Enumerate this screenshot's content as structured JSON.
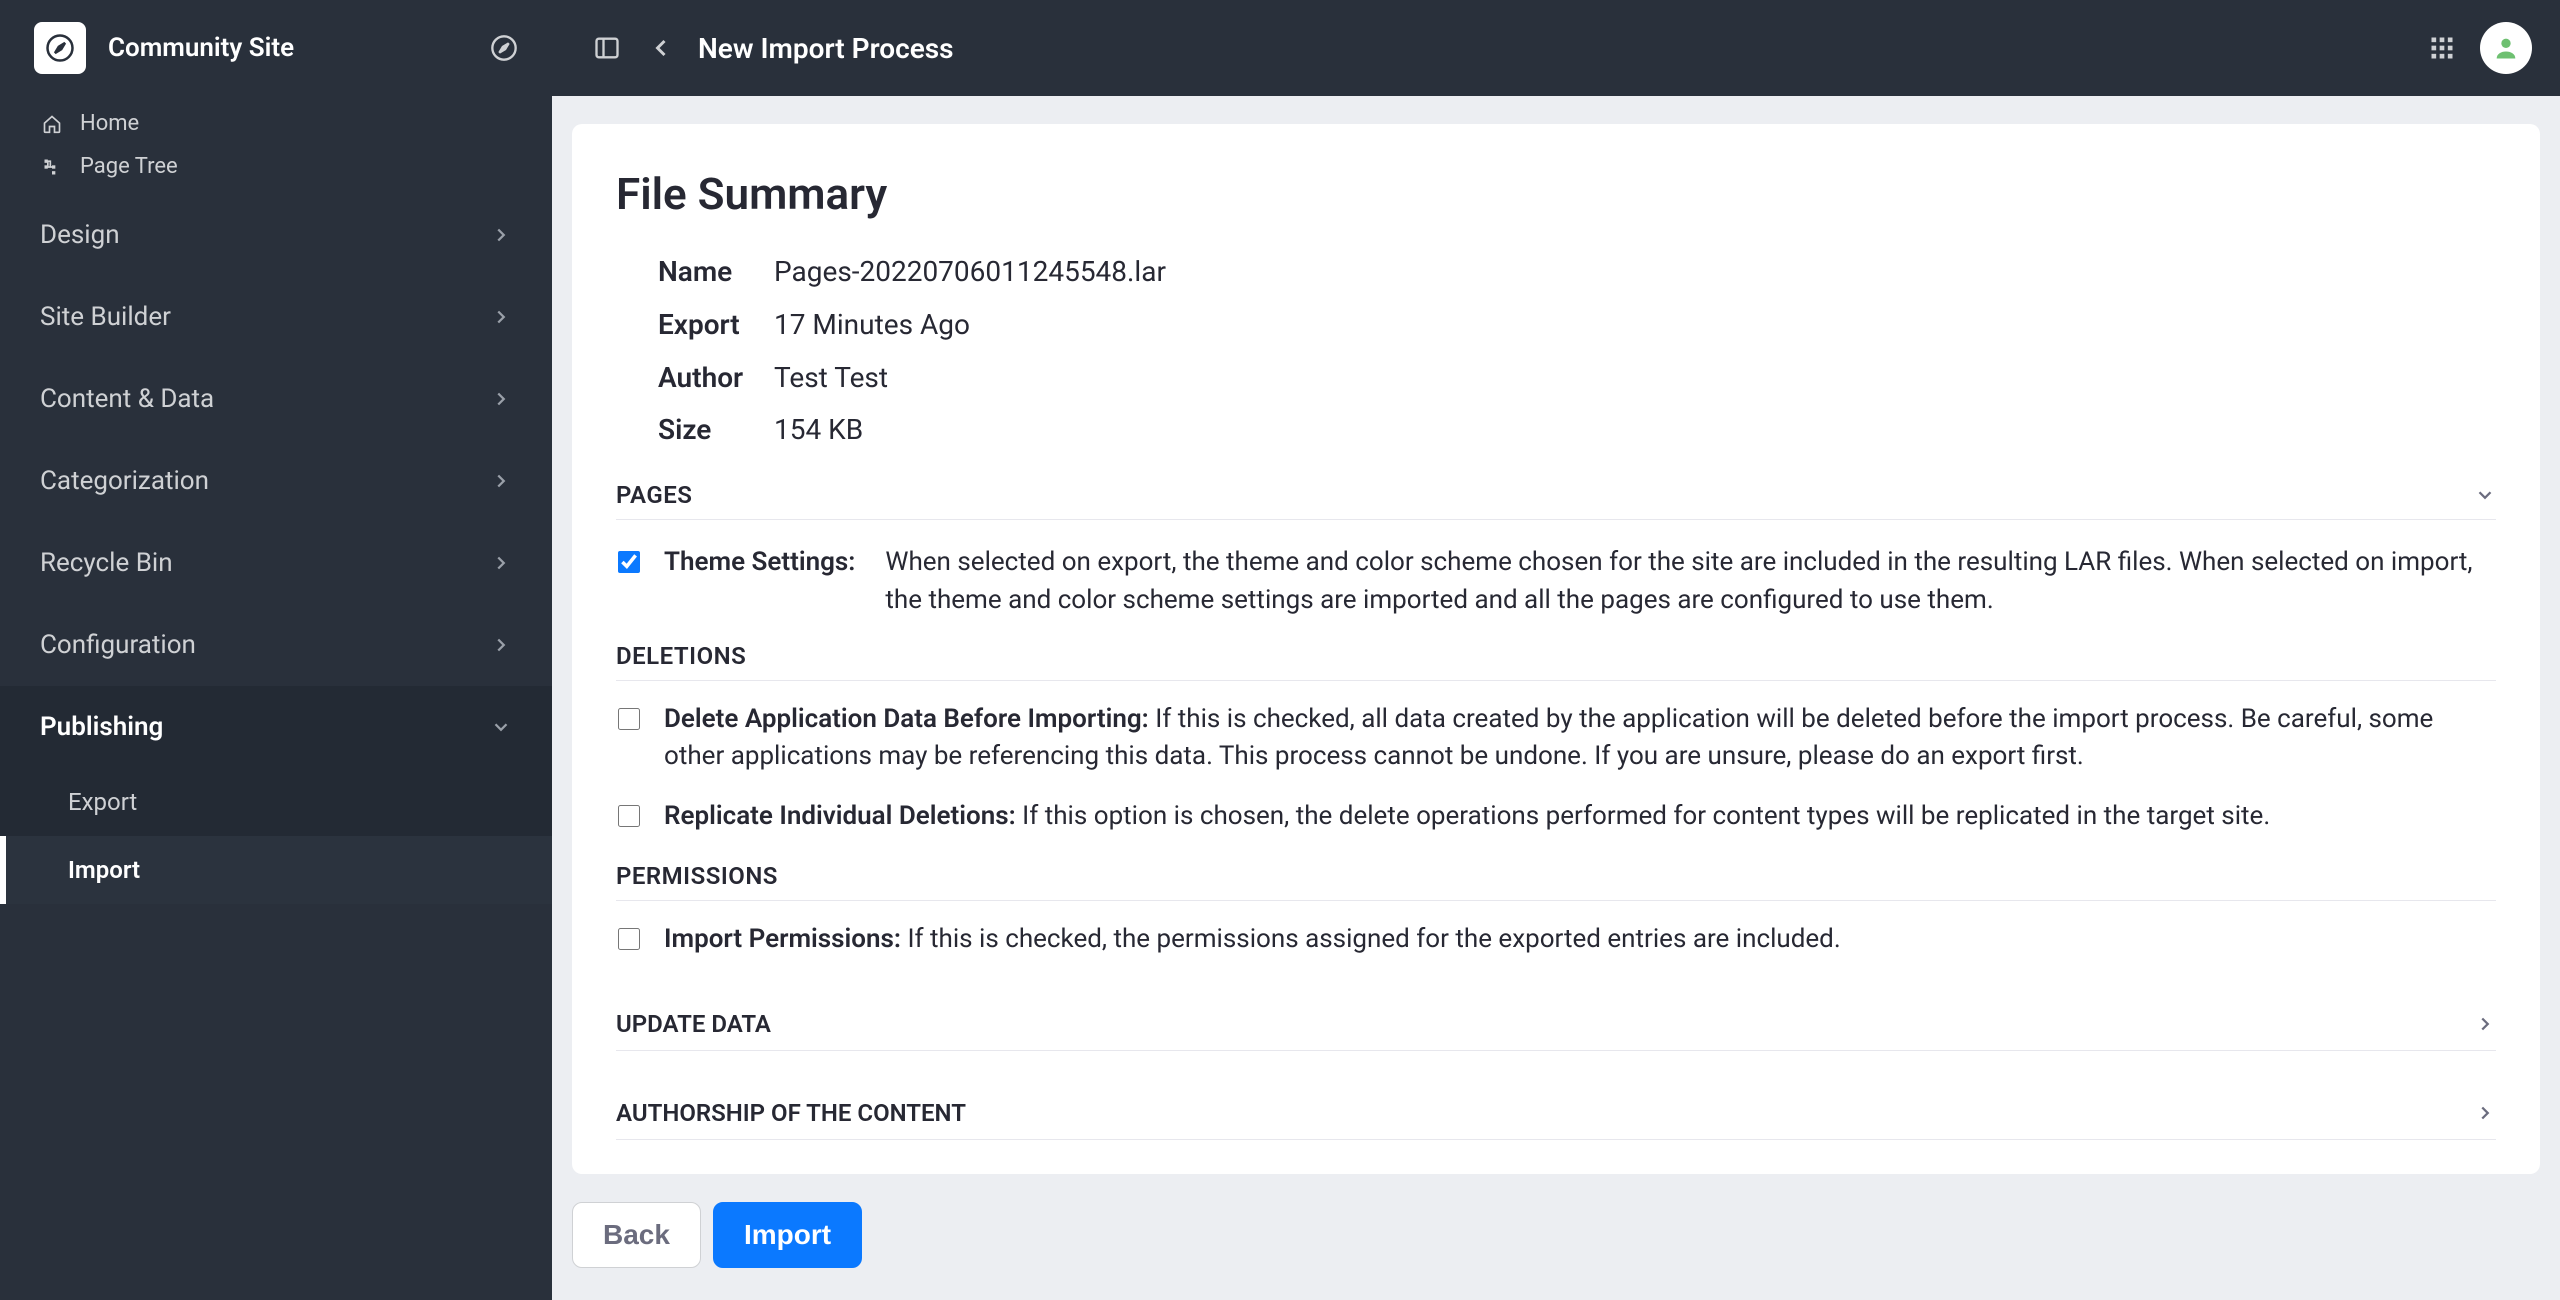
{
  "sidebar": {
    "site_name": "Community Site",
    "top_links": [
      {
        "label": "Home"
      },
      {
        "label": "Page Tree"
      }
    ],
    "sections": [
      {
        "label": "Design",
        "open": false
      },
      {
        "label": "Site Builder",
        "open": false
      },
      {
        "label": "Content & Data",
        "open": false
      },
      {
        "label": "Categorization",
        "open": false
      },
      {
        "label": "Recycle Bin",
        "open": false
      },
      {
        "label": "Configuration",
        "open": false
      },
      {
        "label": "Publishing",
        "open": true,
        "items": [
          {
            "label": "Export",
            "active": false
          },
          {
            "label": "Import",
            "active": true
          }
        ]
      }
    ]
  },
  "topbar": {
    "title": "New Import Process"
  },
  "summary": {
    "heading": "File Summary",
    "meta": {
      "name_label": "Name",
      "name_value": "Pages-20220706011245548.lar",
      "export_label": "Export",
      "export_value": "17 Minutes Ago",
      "author_label": "Author",
      "author_value": "Test Test",
      "size_label": "Size",
      "size_value": "154 KB"
    },
    "pages": {
      "header": "PAGES",
      "theme_label": "Theme Settings:",
      "theme_desc": "When selected on export, the theme and color scheme chosen for the site are included in the resulting LAR files. When selected on import, the theme and color scheme settings are imported and all the pages are configured to use them.",
      "theme_checked": true
    },
    "deletions": {
      "header": "DELETIONS",
      "opt1_label": "Delete Application Data Before Importing:",
      "opt1_desc": "If this is checked, all data created by the application will be deleted before the import process. Be careful, some other applications may be referencing this data. This process cannot be undone. If you are unsure, please do an export first.",
      "opt1_checked": false,
      "opt2_label": "Replicate Individual Deletions:",
      "opt2_desc": "If this option is chosen, the delete operations performed for content types will be replicated in the target site.",
      "opt2_checked": false
    },
    "permissions": {
      "header": "PERMISSIONS",
      "opt_label": "Import Permissions:",
      "opt_desc": "If this is checked, the permissions assigned for the exported entries are included.",
      "opt_checked": false
    },
    "collapsed": [
      {
        "header": "UPDATE DATA"
      },
      {
        "header": "AUTHORSHIP OF THE CONTENT"
      }
    ]
  },
  "buttons": {
    "back": "Back",
    "import": "Import"
  }
}
